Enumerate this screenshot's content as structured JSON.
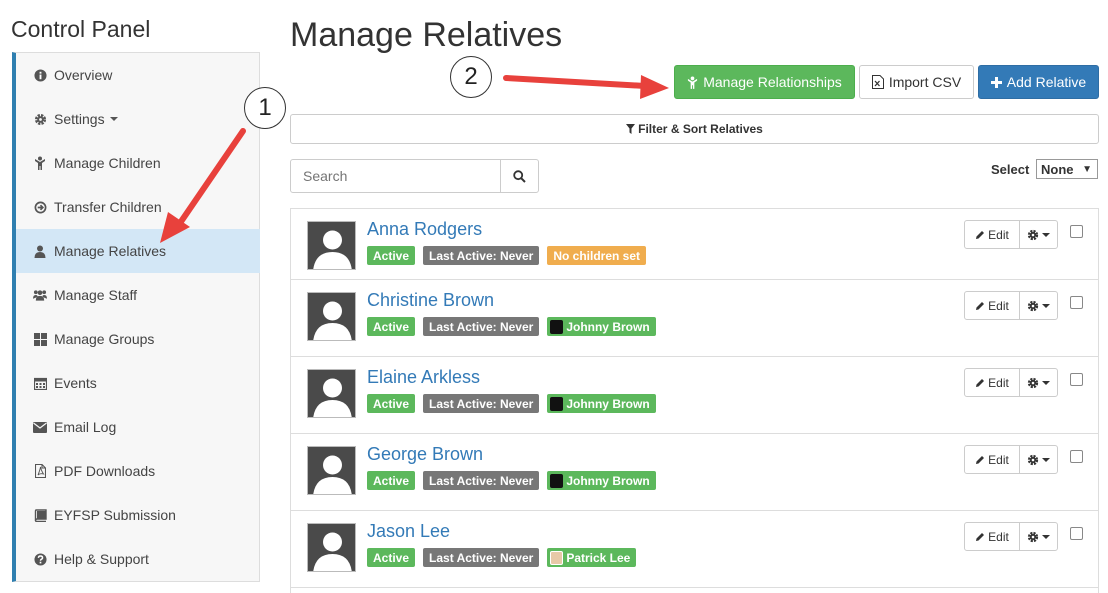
{
  "control_panel_title": "Control Panel",
  "sidebar": {
    "items": [
      {
        "label": "Overview",
        "icon": "info-circle-icon"
      },
      {
        "label": "Settings",
        "icon": "gear-icon"
      },
      {
        "label": "Manage Children",
        "icon": "child-icon"
      },
      {
        "label": "Transfer Children",
        "icon": "transfer-icon"
      },
      {
        "label": "Manage Relatives",
        "icon": "user-icon",
        "active": true
      },
      {
        "label": "Manage Staff",
        "icon": "users-icon"
      },
      {
        "label": "Manage Groups",
        "icon": "grid-icon"
      },
      {
        "label": "Events",
        "icon": "calendar-icon"
      },
      {
        "label": "Email Log",
        "icon": "envelope-icon"
      },
      {
        "label": "PDF Downloads",
        "icon": "pdf-file-icon"
      },
      {
        "label": "EYFSP Submission",
        "icon": "book-icon"
      },
      {
        "label": "Help & Support",
        "icon": "question-circle-icon"
      }
    ]
  },
  "page_title": "Manage Relatives",
  "toolbar": {
    "manage_relationships": "Manage Relationships",
    "import_csv": "Import CSV",
    "add_relative": "Add Relative"
  },
  "filter_label": "Filter & Sort Relatives",
  "search": {
    "placeholder": "Search"
  },
  "select": {
    "label": "Select",
    "value": "None"
  },
  "edit_label": "Edit",
  "relatives": [
    {
      "name": "Anna Rodgers",
      "status": "Active",
      "last_active": "Last Active: Never",
      "child": "No children set",
      "child_type": "none"
    },
    {
      "name": "Christine Brown",
      "status": "Active",
      "last_active": "Last Active: Never",
      "child": "Johnny Brown",
      "child_type": "dark"
    },
    {
      "name": "Elaine Arkless",
      "status": "Active",
      "last_active": "Last Active: Never",
      "child": "Johnny Brown",
      "child_type": "dark"
    },
    {
      "name": "George Brown",
      "status": "Active",
      "last_active": "Last Active: Never",
      "child": "Johnny Brown",
      "child_type": "dark"
    },
    {
      "name": "Jason Lee",
      "status": "Active",
      "last_active": "Last Active: Never",
      "child": "Patrick Lee",
      "child_type": "photo"
    }
  ],
  "callouts": [
    "1",
    "2"
  ],
  "colors": {
    "green": "#5cb85c",
    "blue": "#337ab7",
    "gray": "#777777",
    "orange": "#f0ad4e",
    "arrow": "#e8413c",
    "sidebar_accent": "#2f7fb0"
  }
}
